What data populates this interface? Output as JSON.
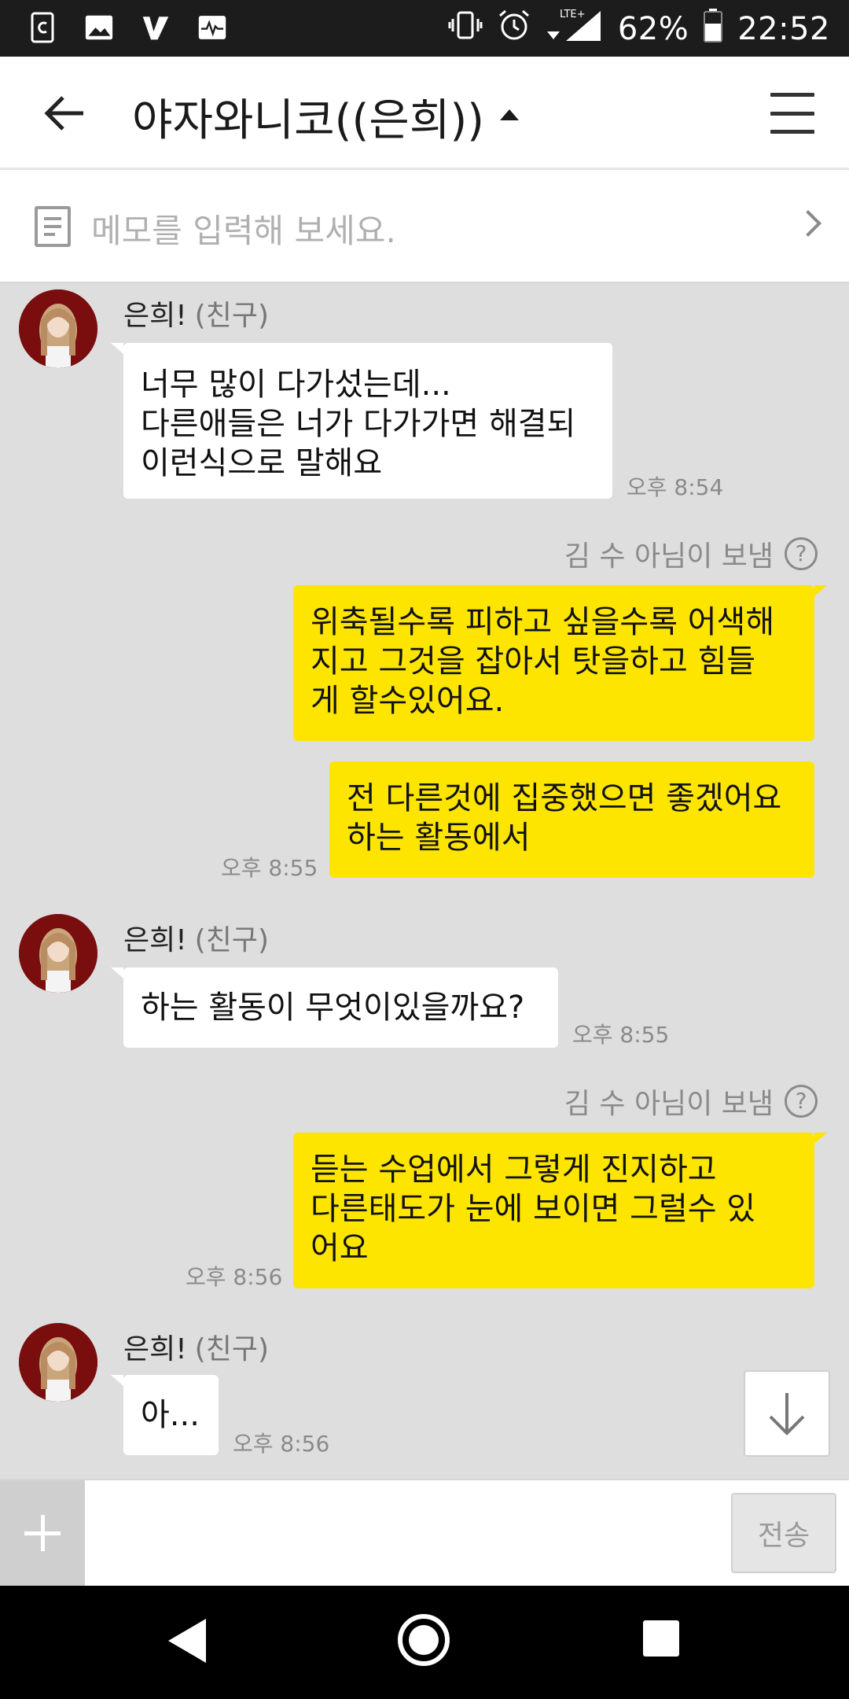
{
  "status_bar": {
    "battery": "62%",
    "time": "22:52",
    "network": "LTE+",
    "left_icons": [
      "sync-app-icon",
      "gallery-icon",
      "v-app-icon",
      "activity-icon"
    ],
    "right_icons": [
      "vibrate-icon",
      "alarm-icon",
      "signal-icon",
      "battery-icon"
    ]
  },
  "header": {
    "title": "야자와니코((은희))"
  },
  "memo": {
    "placeholder": "메모를 입력해 보세요."
  },
  "messages": [
    {
      "type": "received",
      "sender": "은희!",
      "relation": "(친구)",
      "text": "너무 많이 다가섰는데...\n다른애들은 너가 다가가면 해결되\n이런식으로 말해요",
      "time": "오후 8:54"
    },
    {
      "type": "sent",
      "sent_by": "김 수 아님이 보냄",
      "text": "위축될수록 피하고 싶을수록 어색해\n지고 그것을 잡아서 탓을하고 힘들\n게 할수있어요.",
      "time": ""
    },
    {
      "type": "sent",
      "text": "전 다른것에 집중했으면 좋겠어요\n하는 활동에서",
      "time": "오후 8:55"
    },
    {
      "type": "received",
      "sender": "은희!",
      "relation": "(친구)",
      "text": "하는 활동이 무엇이있을까요?",
      "time": "오후 8:55"
    },
    {
      "type": "sent",
      "sent_by": "김 수 아님이 보냄",
      "text": "듣는 수업에서 그렇게 진지하고\n다른태도가 눈에 보이면 그럴수 있\n어요",
      "time": "오후 8:56"
    },
    {
      "type": "received",
      "sender": "은희!",
      "relation": "(친구)",
      "text": "아...",
      "time": "오후 8:56"
    }
  ],
  "input": {
    "value": "",
    "send_label": "전송"
  },
  "colors": {
    "sent_bubble": "#fee500",
    "received_bubble": "#ffffff",
    "chat_bg": "#dedede"
  }
}
